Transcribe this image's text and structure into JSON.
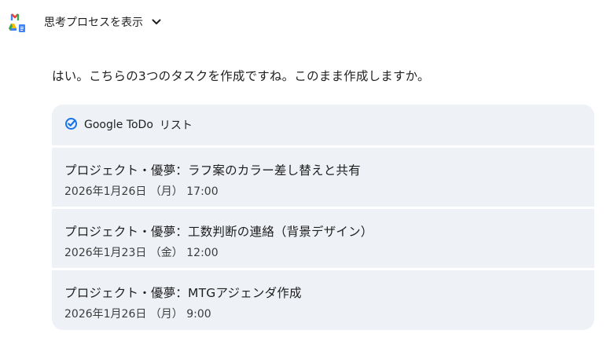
{
  "header": {
    "show_thinking_label": "思考プロセスを表示"
  },
  "message": {
    "text": "はい。こちらの3つのタスクを作成ですね。このまま作成しますか。"
  },
  "todo": {
    "brand": "Google ToDo",
    "list_label": "リスト",
    "tasks": [
      {
        "title": "プロジェクト・優夢：ラフ案のカラー差し替えと共有",
        "date": "2026年1月26日 （月） 17:00"
      },
      {
        "title": "プロジェクト・優夢：工数判断の連絡（背景デザイン）",
        "date": "2026年1月23日 （金） 12:00"
      },
      {
        "title": "プロジェクト・優夢：MTGアジェンダ作成",
        "date": "2026年1月26日 （月） 9:00"
      }
    ]
  },
  "colors": {
    "panel_bg": "#eef1f6",
    "todo_accent": "#1a73e8"
  }
}
